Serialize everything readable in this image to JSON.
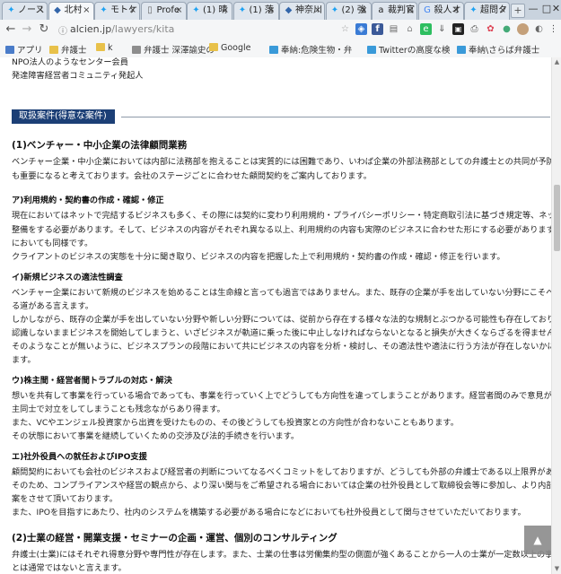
{
  "browser": {
    "tabs": [
      {
        "icon": "twitter-icon",
        "label": "ノース"
      },
      {
        "icon": "site-icon",
        "label": "北村"
      },
      {
        "icon": "twitter-icon",
        "label": "モトケ"
      },
      {
        "icon": "doc-icon",
        "label": "Profe"
      },
      {
        "icon": "twitter-icon",
        "label": "(1) 晴"
      },
      {
        "icon": "twitter-icon",
        "label": "(1) 落"
      },
      {
        "icon": "site-icon",
        "label": "神奈川"
      },
      {
        "icon": "twitter-icon",
        "label": "(2) 強"
      },
      {
        "icon": "amazon-icon",
        "label": "裁判官"
      },
      {
        "icon": "google-icon",
        "label": "殺人オ"
      },
      {
        "icon": "twitter-icon",
        "label": "超問ク"
      }
    ],
    "active_tab_index": 1,
    "url_host": "alcien.jp",
    "url_path": "/lawyers/kita",
    "bookmarks": [
      {
        "label": "アプリ",
        "color": "#4a7cc9"
      },
      {
        "label": "弁護士",
        "color": "#e8c14a"
      },
      {
        "label": "k",
        "color": "#e8c14a"
      },
      {
        "label": "弁護士 深澤諭史の",
        "color": "#8d8d8d"
      },
      {
        "label": "Google",
        "color": "#e8c14a"
      },
      {
        "label": "奉納:危険生物・弁",
        "color": "#3a9ad9"
      },
      {
        "label": "Twitterの高度な検",
        "color": "#3a9ad9"
      },
      {
        "label": "奉納\\さらば弁護士",
        "color": "#3a9ad9"
      }
    ]
  },
  "content": {
    "top_lines": [
      "NPO法人のようなセンター会員",
      "発達障害経営者コミュニティ発起人"
    ],
    "section_heading": "取扱案件(得意な案件)",
    "sec1_title": "(1)ベンチャー・中小企業の法律顧問業務",
    "sec1_lines": [
      "ベンチャー企業・中小企業においては内部に法務部を抱えることは実質的には困難であり、いわば企業の外部法務部としての弁護士との共同が予防法務の観点か",
      "も重要になると考えております。会社のステージごとに合わせた顧問契約をご案内しております。"
    ],
    "a_title": "ア)利用規約・契約書の作成・確認・修正",
    "a_lines": [
      "現在においてはネットで完結するビジネスも多く、その際には契約に変わり利用規約・プライバシーポリシー・特定商取引法に基づき規定等、ネット上に掲載する情報",
      "整備をする必要があります。そして、ビジネスの内容がそれぞれ異なる以上、利用規約の内容も実際のビジネスに合わせた形にする必要があります。これは個別の契",
      "においても同様です。",
      "クライアントのビジネスの実態を十分に聞き取り、ビジネスの内容を把握した上で利用規約・契約書の作成・確認・修正を行います。"
    ],
    "i_title": "イ)新規ビジネスの適法性調査",
    "i_lines": [
      "ベンチャー企業において新規のビジネスを始めることは生命線と言っても過言ではありません。また、既存の企業が手を出していない分野にこそベンチャー企業の生",
      "る道がある言えます。",
      "しかしながら、既存の企業が手を出していない分野や新しい分野については、従前から存在する様々な法的な規制とぶつかる可能性も存在しており、そのような事実",
      "認識しないままビジネスを開始してしまうと、いざビジネスが軌道に乗った後に中止しなければならないとなると損失が大きくならざるを得ません。",
      "そのようなことが無いように、ビジネスプランの段階において共にビジネスの内容を分析・検討し、その適法性や適法に行う方法が存在しないかについての調査を行",
      "ます。"
    ],
    "u_title": "ウ)株主間・経営者間トラブルの対応・解決",
    "u_lines": [
      "想いを共有して事業を行っている場合であっても、事業を行っていく上でどうしても方向性を違ってしまうことがあります。経営者間のみで意見が割れることもあれば、",
      "主同士で対立をしてしまうことも残念ながらあり得ます。",
      "また、VCやエンジェル投資家から出資を受けたものの、その後どうしても投資家との方向性が合わないこともあります。",
      "その状態において事業を継続していくための交渉及び法的手続きを行います。"
    ],
    "e_title": "エ)社外役員への就任およびIPO支援",
    "e_lines": [
      "顧問契約においても会社のビジネスおよび経営者の判断についてなるべくコミットをしておりますが、どうしても外部の弁護士である以上限界があります。",
      "そのため、コンプライアンスや経営の観点から、より深い関与をご希望される場合においては企業の社外役員として取締役会等に参加し、より内部に入った観点から",
      "案をさせて頂いております。",
      "また、IPOを目指すにあたり、社内のシステムを構築する必要がある場合になどにおいても社外役員として関与させていただいております。"
    ],
    "sec2_title": "(2)士業の経営・開業支援・セミナーの企画・運営、個別のコンサルティング",
    "sec2_lines": [
      "弁護士(士業)にはそれぞれ得意分野や専門性が存在します。また、士業の仕事は労働集約型の側面が強くあることから一人の士業が一定数以上の事件を処理し",
      "とは通常ではないと言えます。"
    ]
  }
}
